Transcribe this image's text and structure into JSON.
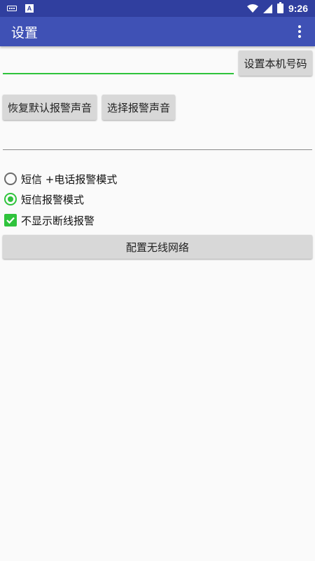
{
  "status_bar": {
    "time": "9:26"
  },
  "app_bar": {
    "title": "设置"
  },
  "phone_field": {
    "value": "",
    "placeholder": ""
  },
  "buttons": {
    "set_number": "设置本机号码",
    "restore_default_sound": "恢复默认报警声音",
    "select_sound": "选择报警声音",
    "configure_wifi": "配置无线网络"
  },
  "second_field": {
    "value": ""
  },
  "options": {
    "sms_call_mode": "短信 +电话报警模式",
    "sms_mode": "短信报警模式",
    "no_disconnect_alarm": "不显示断线报警"
  },
  "colors": {
    "status_bar": "#303f9f",
    "app_bar": "#3f51b5",
    "accent": "#2fc33c",
    "button_bg": "#d8d8d8"
  }
}
